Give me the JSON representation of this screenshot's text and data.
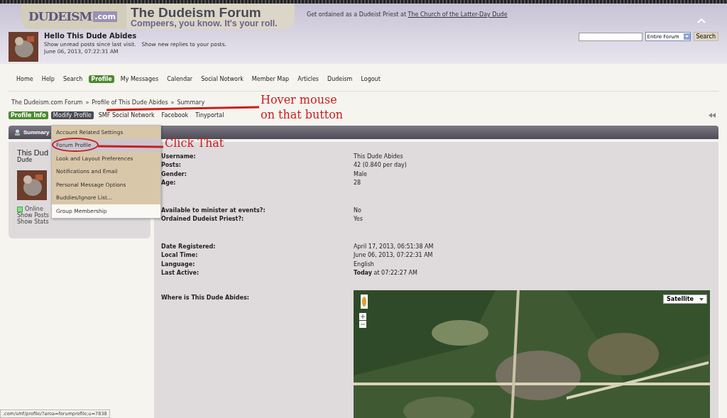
{
  "header": {
    "logo": {
      "brand": "DUDEISM",
      "suffix": ".com",
      "title": "The Dudeism Forum",
      "slogan": "Compeers, you know. It's your roll."
    },
    "promo": {
      "text": "Get ordained as a Dudeist Priest at",
      "link": "The Church of the Latter-Day Dude"
    }
  },
  "user_bar": {
    "greeting": "Hello This Dude Abides",
    "links": [
      "Show unread posts since last visit.",
      "Show new replies to your posts."
    ],
    "date": "June 06, 2013, 07:22:31 AM",
    "search": {
      "scope": "Entire Forum",
      "button": "Search"
    }
  },
  "menu": [
    {
      "label": "Home",
      "selected": false
    },
    {
      "label": "Help",
      "selected": false
    },
    {
      "label": "Search",
      "selected": false
    },
    {
      "label": "Profile",
      "selected": true
    },
    {
      "label": "My Messages",
      "selected": false
    },
    {
      "label": "Calendar",
      "selected": false
    },
    {
      "label": "Social Notwork",
      "selected": false
    },
    {
      "label": "Member Map",
      "selected": false
    },
    {
      "label": "Articles",
      "selected": false
    },
    {
      "label": "Dudeism",
      "selected": false
    },
    {
      "label": "Logout",
      "selected": false
    }
  ],
  "breadcrumb": {
    "separator": "»",
    "items": [
      "The Dudeism.com Forum",
      "Profile of This Dude Abides",
      "Summary"
    ]
  },
  "profile_tabs": [
    {
      "label": "Profile Info",
      "selected": true,
      "hovered": false
    },
    {
      "label": "Modify Profile",
      "selected": false,
      "hovered": true
    },
    {
      "label": "SMF Social Network",
      "selected": false,
      "hovered": false
    },
    {
      "label": "Facebook",
      "selected": false,
      "hovered": false
    },
    {
      "label": "Tinyportal",
      "selected": false,
      "hovered": false
    }
  ],
  "section_title": "Summary",
  "dropdown": [
    {
      "label": "Account Related Settings",
      "kind": "settings",
      "selected": false
    },
    {
      "label": "Forum Profile",
      "kind": "settings",
      "selected": true
    },
    {
      "label": "Look and Layout Preferences",
      "kind": "settings",
      "selected": false
    },
    {
      "label": "Notifications and Email",
      "kind": "settings",
      "selected": false
    },
    {
      "label": "Personal Message Options",
      "kind": "settings",
      "selected": false
    },
    {
      "label": "Buddies/Ignore List...",
      "kind": "settings",
      "selected": false
    },
    {
      "label": "Group Membership",
      "kind": "group",
      "selected": false
    }
  ],
  "user_card": {
    "name": "This Dud",
    "title": "Dude",
    "status": "Online",
    "online": true,
    "links": [
      "Show Posts",
      "Show Stats"
    ]
  },
  "details": [
    [
      {
        "label": "Username:",
        "value": "This Dude Abides"
      },
      {
        "label": "Posts:",
        "value": "42 (0.840 per day)"
      },
      {
        "label": "Gender:",
        "value": "Male"
      },
      {
        "label": "Age:",
        "value": "28"
      }
    ],
    [
      {
        "label": "Available to minister at events?:",
        "value": "No"
      },
      {
        "label": "Ordained Dudeist Priest?:",
        "value": "Yes"
      }
    ],
    [
      {
        "label": "Date Registered:",
        "value": "April 17, 2013, 06:51:38 AM"
      },
      {
        "label": "Local Time:",
        "value": "June 06, 2013, 07:22:31 AM"
      },
      {
        "label": "Language:",
        "value": "English"
      },
      {
        "label": "Last Active:",
        "value": "**Today** at 07:22:27 AM"
      }
    ]
  ],
  "location": {
    "label": "Where is This Dude Abides:",
    "map": {
      "kind": "picture",
      "map_type": "Satellite"
    }
  },
  "status_url": ".com/smf/profile/?area=forumprofile;u=7838",
  "annotations": [
    {
      "kind": "hover",
      "lines": [
        "Hover mouse",
        "on that button"
      ]
    },
    {
      "kind": "click",
      "lines": [
        "Click That"
      ]
    }
  ]
}
